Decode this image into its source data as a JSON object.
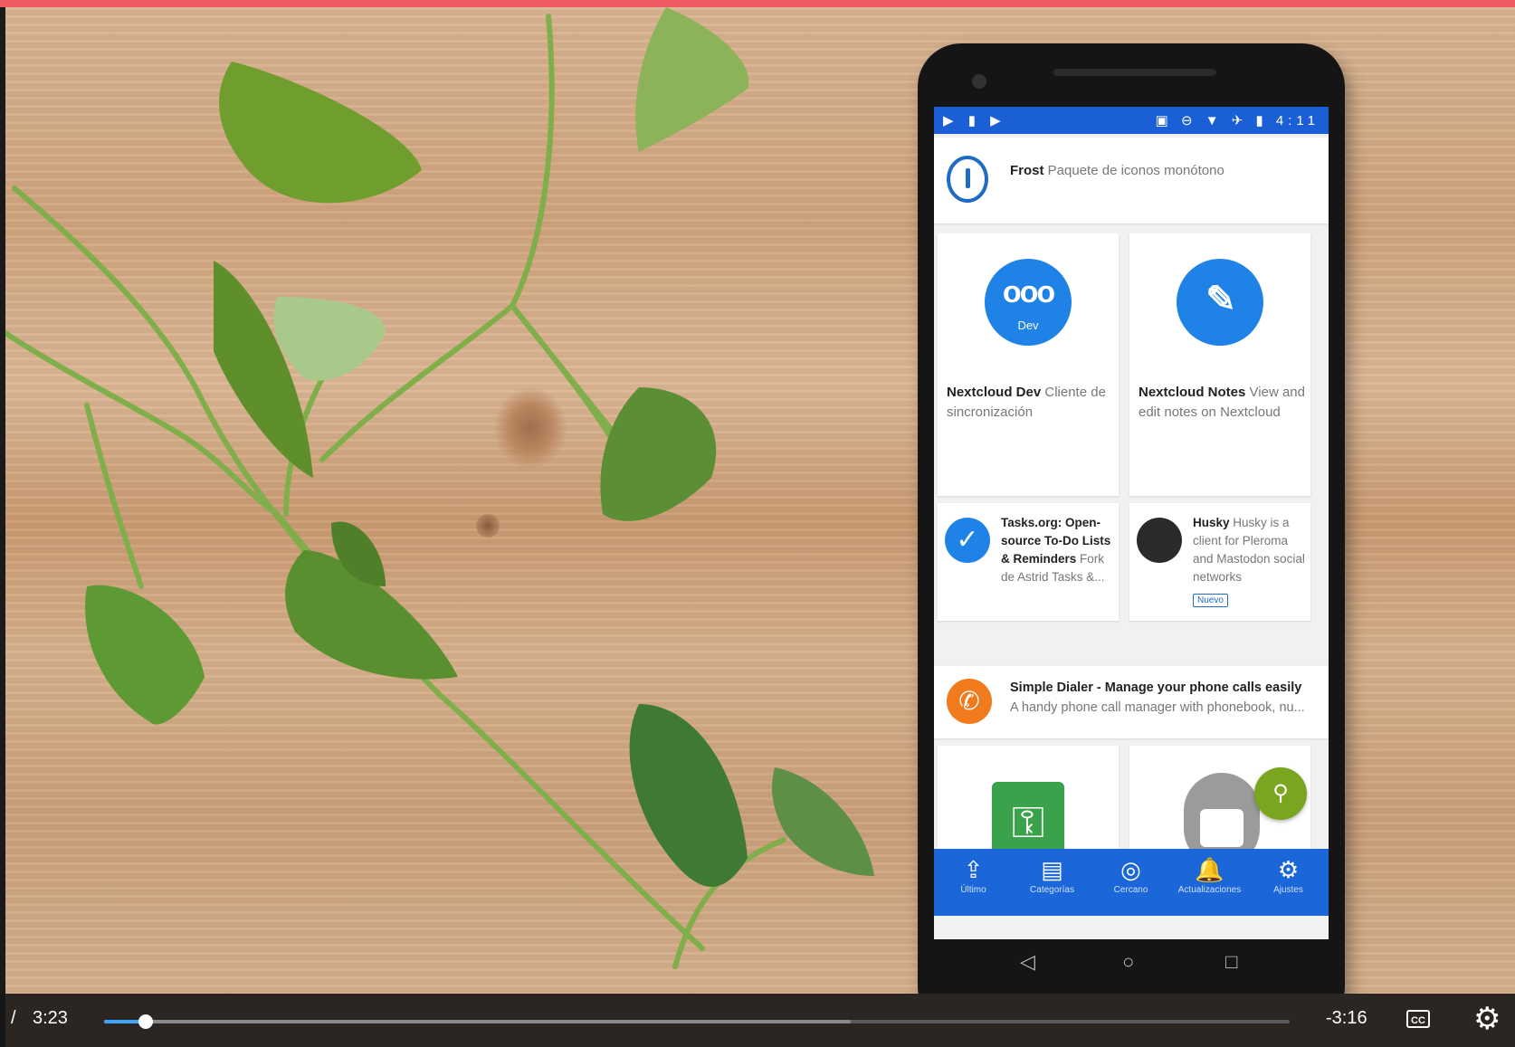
{
  "player": {
    "separator": "/",
    "current_time": "3:23",
    "remaining_time": "-3:16",
    "progress_fraction": 0.035,
    "buffered_fraction": 0.63,
    "cc_label": "CC",
    "accent": "#3ea6ff"
  },
  "phone": {
    "status_left": "▶ ▮ ▶",
    "status_right": "▣ ⊖ ▼ ✈ ▮ 4:11",
    "frost": {
      "name": "Frost",
      "desc": "Paquete de iconos monótono"
    },
    "apps": [
      {
        "name": "Nextcloud Dev",
        "desc": "Cliente de sincronización",
        "icon_glyph": "ooo",
        "icon_sub": "Dev"
      },
      {
        "name": "Nextcloud Notes",
        "desc": "View and edit notes on Nextcloud",
        "icon_glyph": "✎"
      }
    ],
    "small_apps": [
      {
        "name": "Tasks.org: Open-source To-Do Lists & Reminders",
        "desc": "Fork de Astrid Tasks &..."
      },
      {
        "name": "Husky",
        "desc": "Husky is a client for Pleroma and Mastodon social networks",
        "badge": "Nuevo"
      }
    ],
    "dialer": {
      "name": "Simple Dialer - Manage your phone calls easily",
      "desc": "A handy phone call manager with phonebook, nu..."
    },
    "bottom_nav": [
      {
        "icon": "upload-star-icon",
        "glyph": "⇪",
        "label": "Último"
      },
      {
        "icon": "categories-icon",
        "glyph": "▤",
        "label": "Categorías"
      },
      {
        "icon": "nearby-icon",
        "glyph": "◎",
        "label": "Cercano"
      },
      {
        "icon": "bell-icon",
        "glyph": "🔔",
        "label": "Actualizaciones"
      },
      {
        "icon": "gear-icon",
        "glyph": "⚙",
        "label": "Ajustes"
      }
    ],
    "android_nav": [
      "◁",
      "○",
      "□"
    ],
    "nav_color": "#1b66d9",
    "fab_glyph": "⚲"
  }
}
